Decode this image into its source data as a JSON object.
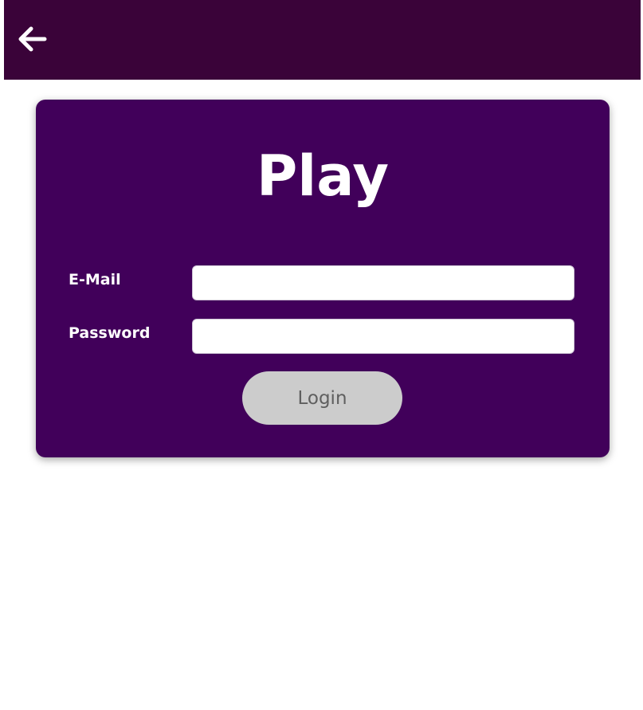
{
  "header": {
    "back_icon": "arrow-left-icon",
    "background_color": "#3a0339",
    "icon_color": "#ffffff"
  },
  "card": {
    "title": "Play",
    "background_color": "#41005a",
    "email": {
      "label": "E-Mail",
      "value": ""
    },
    "password": {
      "label": "Password",
      "value": ""
    },
    "login_button": {
      "label": "Login",
      "background_color": "#cccccc",
      "text_color": "#5f5f5f"
    }
  }
}
